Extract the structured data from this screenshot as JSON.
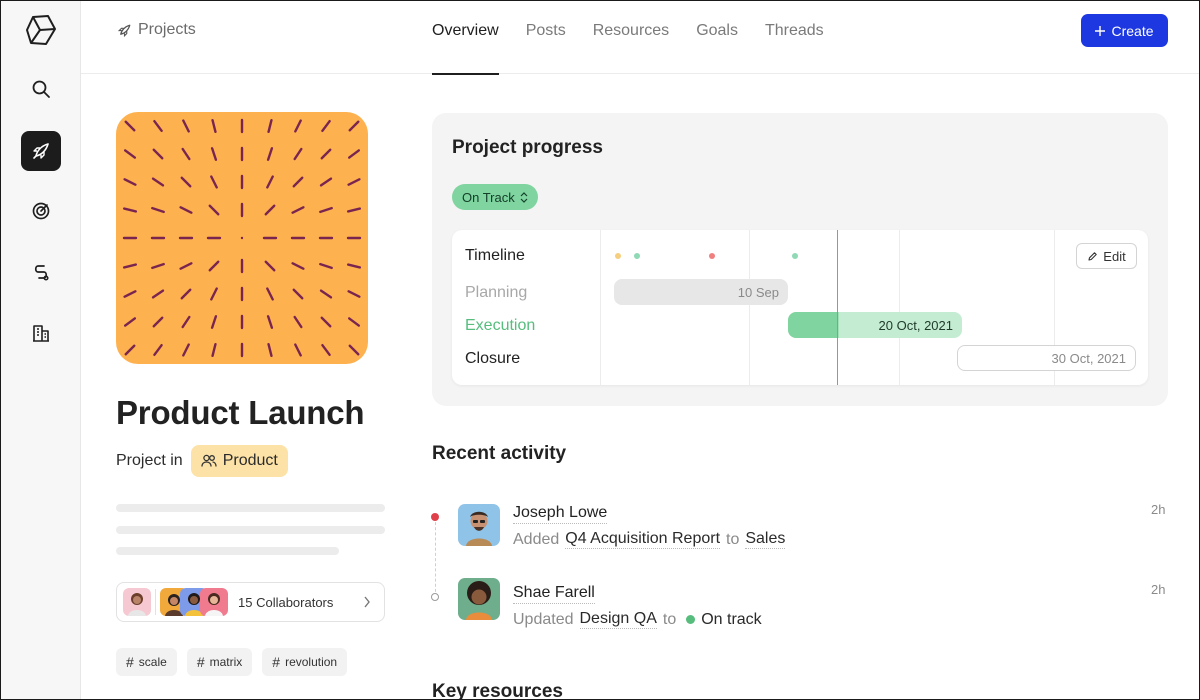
{
  "header": {
    "breadcrumb": "Projects",
    "tabs": [
      {
        "label": "Overview",
        "active": true
      },
      {
        "label": "Posts"
      },
      {
        "label": "Resources"
      },
      {
        "label": "Goals"
      },
      {
        "label": "Threads"
      }
    ],
    "create_label": "Create"
  },
  "rail": {
    "items": [
      "search-icon",
      "rocket-icon",
      "target-icon",
      "route-icon",
      "buildings-icon"
    ],
    "active": "rocket-icon"
  },
  "project": {
    "title": "Product Launch",
    "project_in_label": "Project in",
    "team": "Product",
    "collaborators_label": "15 Collaborators",
    "tags": [
      "scale",
      "matrix",
      "revolution"
    ]
  },
  "progress": {
    "title": "Project progress",
    "status": "On Track",
    "timeline_label": "Timeline",
    "edit_label": "Edit",
    "phases": [
      {
        "name": "Planning",
        "date": "10 Sep"
      },
      {
        "name": "Execution",
        "date": "20 Oct, 2021"
      },
      {
        "name": "Closure",
        "date": "30 Oct, 2021"
      }
    ]
  },
  "activity": {
    "title": "Recent activity",
    "items": [
      {
        "name": "Joseph Lowe",
        "verb": "Added",
        "object": "Q4 Acquisition Report",
        "connector": "to",
        "target": "Sales",
        "time": "2h"
      },
      {
        "name": "Shae Farell",
        "verb": "Updated",
        "object": "Design QA",
        "connector": "to",
        "target": "On track",
        "time": "2h"
      }
    ]
  },
  "key_resources_title": "Key resources",
  "colors": {
    "accent": "#1d38e0",
    "cover": "#fdb14f",
    "cover_marks": "#7a2550",
    "on_track": "#7fd49f",
    "team_chip": "#fde2a7"
  }
}
